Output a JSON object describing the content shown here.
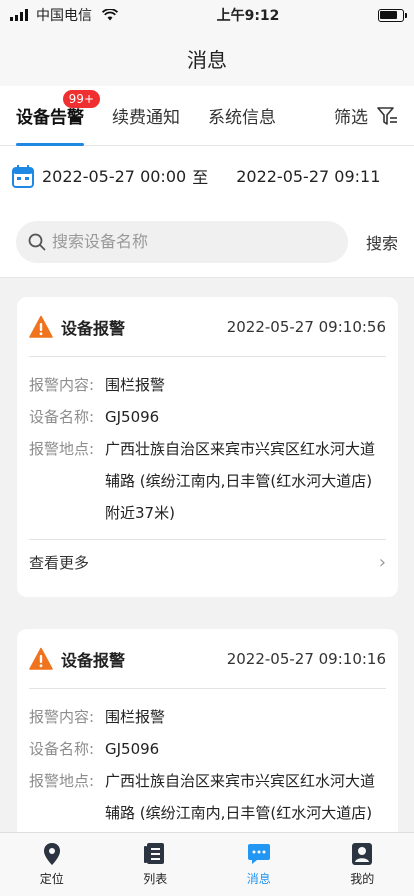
{
  "status_bar": {
    "carrier": "中国电信",
    "time": "上午9:12"
  },
  "header": {
    "title": "消息"
  },
  "tabs": [
    {
      "label": "设备告警",
      "badge": "99+",
      "active": true
    },
    {
      "label": "续费通知",
      "active": false
    },
    {
      "label": "系统信息",
      "active": false
    }
  ],
  "filter": {
    "label": "筛选",
    "icon": "filter-icon"
  },
  "date_range": {
    "start": "2022-05-27 00:00",
    "separator": "至",
    "end": "2022-05-27 09:11"
  },
  "search": {
    "placeholder": "搜索设备名称",
    "button": "搜索"
  },
  "alerts": [
    {
      "title": "设备报警",
      "time": "2022-05-27 09:10:56",
      "content_label": "报警内容:",
      "content": "围栏报警",
      "device_label": "设备名称:",
      "device": "GJ5096",
      "location_label": "报警地点:",
      "location": "广西壮族自治区来宾市兴宾区红水河大道辅路 (缤纷江南内,日丰管(红水河大道店)附近37米)",
      "more_label": "查看更多"
    },
    {
      "title": "设备报警",
      "time": "2022-05-27 09:10:16",
      "content_label": "报警内容:",
      "content": "围栏报警",
      "device_label": "设备名称:",
      "device": "GJ5096",
      "location_label": "报警地点:",
      "location": "广西壮族自治区来宾市兴宾区红水河大道辅路 (缤纷江南内,日丰管(红水河大道店)"
    }
  ],
  "tabbar": [
    {
      "label": "定位",
      "icon": "location-pin-icon",
      "active": false
    },
    {
      "label": "列表",
      "icon": "list-icon",
      "active": false
    },
    {
      "label": "消息",
      "icon": "message-icon",
      "active": true
    },
    {
      "label": "我的",
      "icon": "profile-icon",
      "active": false
    }
  ],
  "colors": {
    "accent": "#1e88e5",
    "badge": "#f03030",
    "warning": "#f0731e"
  }
}
